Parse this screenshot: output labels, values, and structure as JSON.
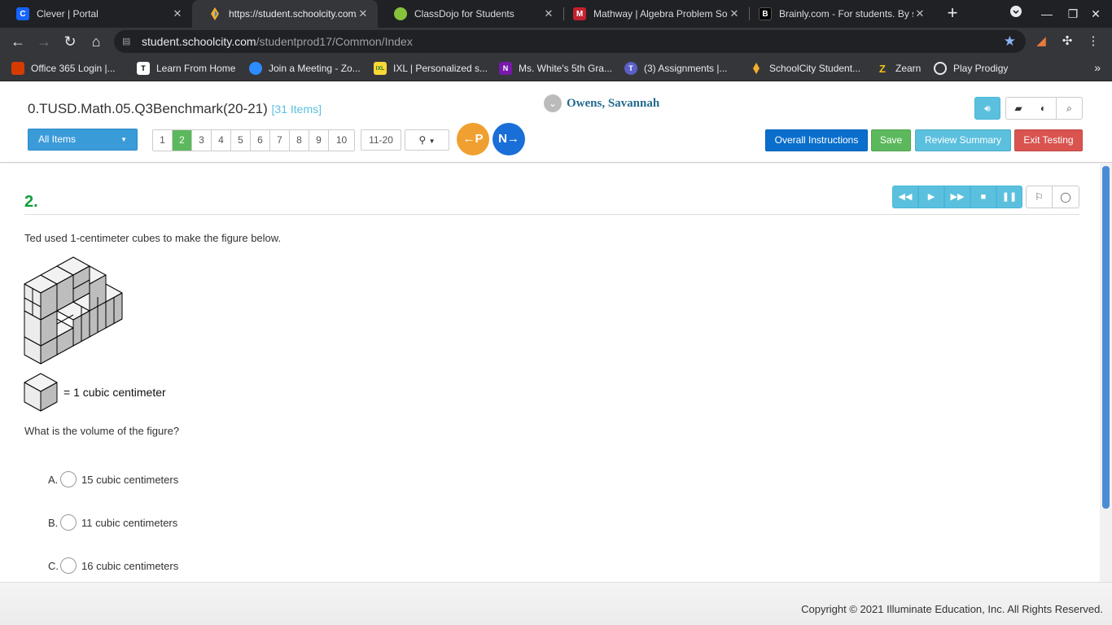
{
  "browser": {
    "tabs": [
      {
        "title": "Clever | Portal",
        "icon": "C",
        "color": "#1464ff"
      },
      {
        "title": "https://student.schoolcity.com/",
        "icon": "",
        "color": "#3d7dd8"
      },
      {
        "title": "ClassDojo for Students",
        "icon": "",
        "color": "#86c33d"
      },
      {
        "title": "Mathway | Algebra Problem Solver",
        "icon": "M",
        "color": "#c3212f"
      },
      {
        "title": "Brainly.com - For students. By students.",
        "icon": "B",
        "color": "#000000"
      }
    ],
    "url_host": "student.schoolcity.com",
    "url_path": "/studentprod17/Common/Index",
    "bookmarks": [
      {
        "label": "Office 365 Login |...",
        "icon": "O"
      },
      {
        "label": "Learn From Home",
        "icon": "T"
      },
      {
        "label": "Join a Meeting - Zo...",
        "icon": "Z"
      },
      {
        "label": "IXL | Personalized s...",
        "icon": "IXL"
      },
      {
        "label": "Ms. White's 5th Gra...",
        "icon": "N"
      },
      {
        "label": "(3) Assignments |...",
        "icon": "T"
      },
      {
        "label": "SchoolCity Student...",
        "icon": ""
      },
      {
        "label": "Zearn",
        "icon": "Z"
      },
      {
        "label": "Play Prodigy",
        "icon": ""
      }
    ]
  },
  "header": {
    "test_title": "0.TUSD.Math.05.Q3Benchmark(20-21)",
    "item_count": "[31 Items]",
    "student_name": "Owens, Savannah",
    "all_items_label": "All Items",
    "pages": [
      "1",
      "2",
      "3",
      "4",
      "5",
      "6",
      "7",
      "8",
      "9",
      "10"
    ],
    "current_page": "2",
    "range_label": "11-20",
    "prev_label": "P",
    "next_label": "N",
    "overall_instructions": "Overall Instructions",
    "save": "Save",
    "review_summary": "Review Summary",
    "exit_testing": "Exit Testing"
  },
  "question": {
    "number": "2.",
    "prompt": "Ted used 1-centimeter cubes to make the figure below.",
    "legend": "= 1 cubic centimeter",
    "text": "What is the volume of the figure?",
    "options": [
      {
        "letter": "A.",
        "text": "15 cubic centimeters"
      },
      {
        "letter": "B.",
        "text": "11 cubic centimeters"
      },
      {
        "letter": "C.",
        "text": "16 cubic centimeters"
      }
    ]
  },
  "footer": {
    "copyright": "Copyright © 2021 Illuminate Education, Inc. All Rights Reserved."
  }
}
